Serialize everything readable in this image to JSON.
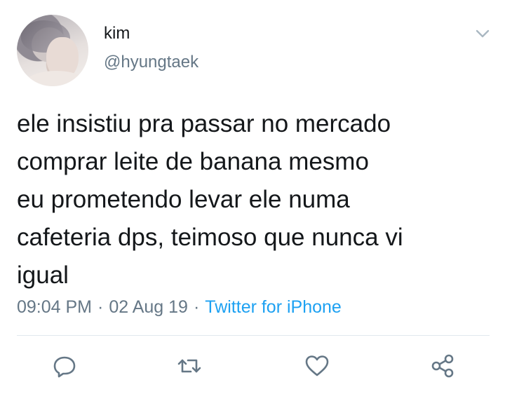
{
  "tweet": {
    "author": {
      "display_name": "kim",
      "handle": "@hyungtaek"
    },
    "text": "ele insistiu pra passar no mercado\ncomprar leite de banana mesmo\neu prometendo levar ele numa\ncafeteria dps, teimoso que nunca vi\nigual",
    "time": "09:04 PM",
    "date": "02 Aug 19",
    "separator": "·",
    "source": "Twitter for iPhone"
  },
  "actions": [
    {
      "icon": "reply-icon"
    },
    {
      "icon": "retweet-icon"
    },
    {
      "icon": "like-icon"
    },
    {
      "icon": "share-icon"
    }
  ],
  "colors": {
    "text": "#14171a",
    "secondary": "#657786",
    "link": "#1da1f2",
    "divider": "#e1e8ed"
  }
}
